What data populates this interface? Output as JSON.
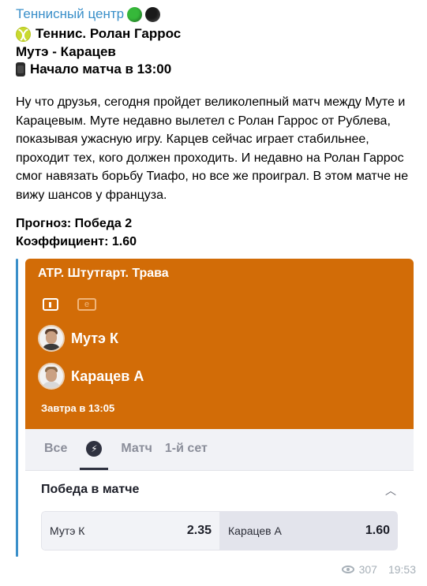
{
  "post": {
    "channel_name": "Теннисный центр",
    "line_sport": "Теннис. Ролан Гаррос",
    "line_match": "Мутэ - Карацев",
    "line_start": "Начало матча в 13:00",
    "paragraph": "Ну что друзья, сегодня пройдет великолепный матч между Муте и Карацевым. Муте недавно вылетел с Ролан Гаррос от Рублева, показывая ужасную игру. Карцев сейчас играет стабильнее, проходит тех, кого должен проходить. И недавно на Ролан Гаррос смог навязать борьбу Тиафо, но все же проиграл. В этом матче не вижу шансов у француза.",
    "forecast": "Прогноз: Победа 2",
    "coefficient": "Коэффициент: 1.60"
  },
  "card": {
    "league": "ATP. Штутгарт. Трава",
    "player1": "Мутэ К",
    "player2": "Карацев А",
    "time": "Завтра в 13:05",
    "tabs": [
      "Все",
      "Матч",
      "1-й сет"
    ],
    "market_title": "Победа в матче",
    "odds": [
      {
        "name": "Мутэ К",
        "value": "2.35"
      },
      {
        "name": "Карацев А",
        "value": "1.60"
      }
    ],
    "colors": {
      "header": "#d26c07",
      "accent": "#3a8fc9"
    }
  },
  "footer": {
    "views": "307",
    "time": "19:53"
  },
  "icons": [
    "green-circle-icon",
    "black-circle-icon",
    "tennis-ball-icon",
    "watch-icon",
    "info-icon",
    "e-icon",
    "bolt-icon",
    "chevron-up-icon",
    "eye-icon"
  ]
}
